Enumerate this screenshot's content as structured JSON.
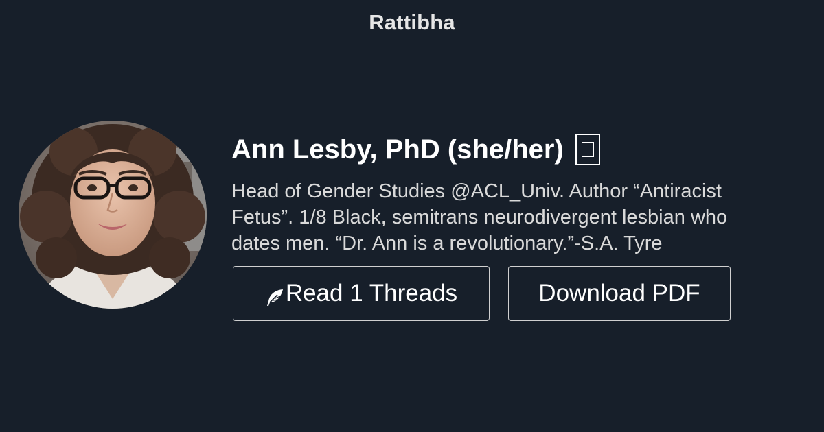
{
  "header": {
    "brand": "Rattibha"
  },
  "profile": {
    "name": "Ann Lesby, PhD (she/her)",
    "name_suffix_icon": "missing-glyph-icon",
    "bio_lines": [
      "Head of Gender Studies @ACL_Univ. Author “Antiracist",
      "Fetus”. 1/8 Black, semitrans neurodivergent lesbian who",
      "dates men. “Dr. Ann is a revolutionary.”-S.A. Tyre"
    ],
    "avatar_icon": "profile-photo"
  },
  "actions": {
    "read_label": "Read 1 Threads",
    "read_icon": "feather-icon",
    "pdf_label": "Download PDF"
  },
  "colors": {
    "background": "#171f2a",
    "text": "#ffffff",
    "muted_text": "#d9d9d9",
    "button_border": "#d0d0d0"
  }
}
